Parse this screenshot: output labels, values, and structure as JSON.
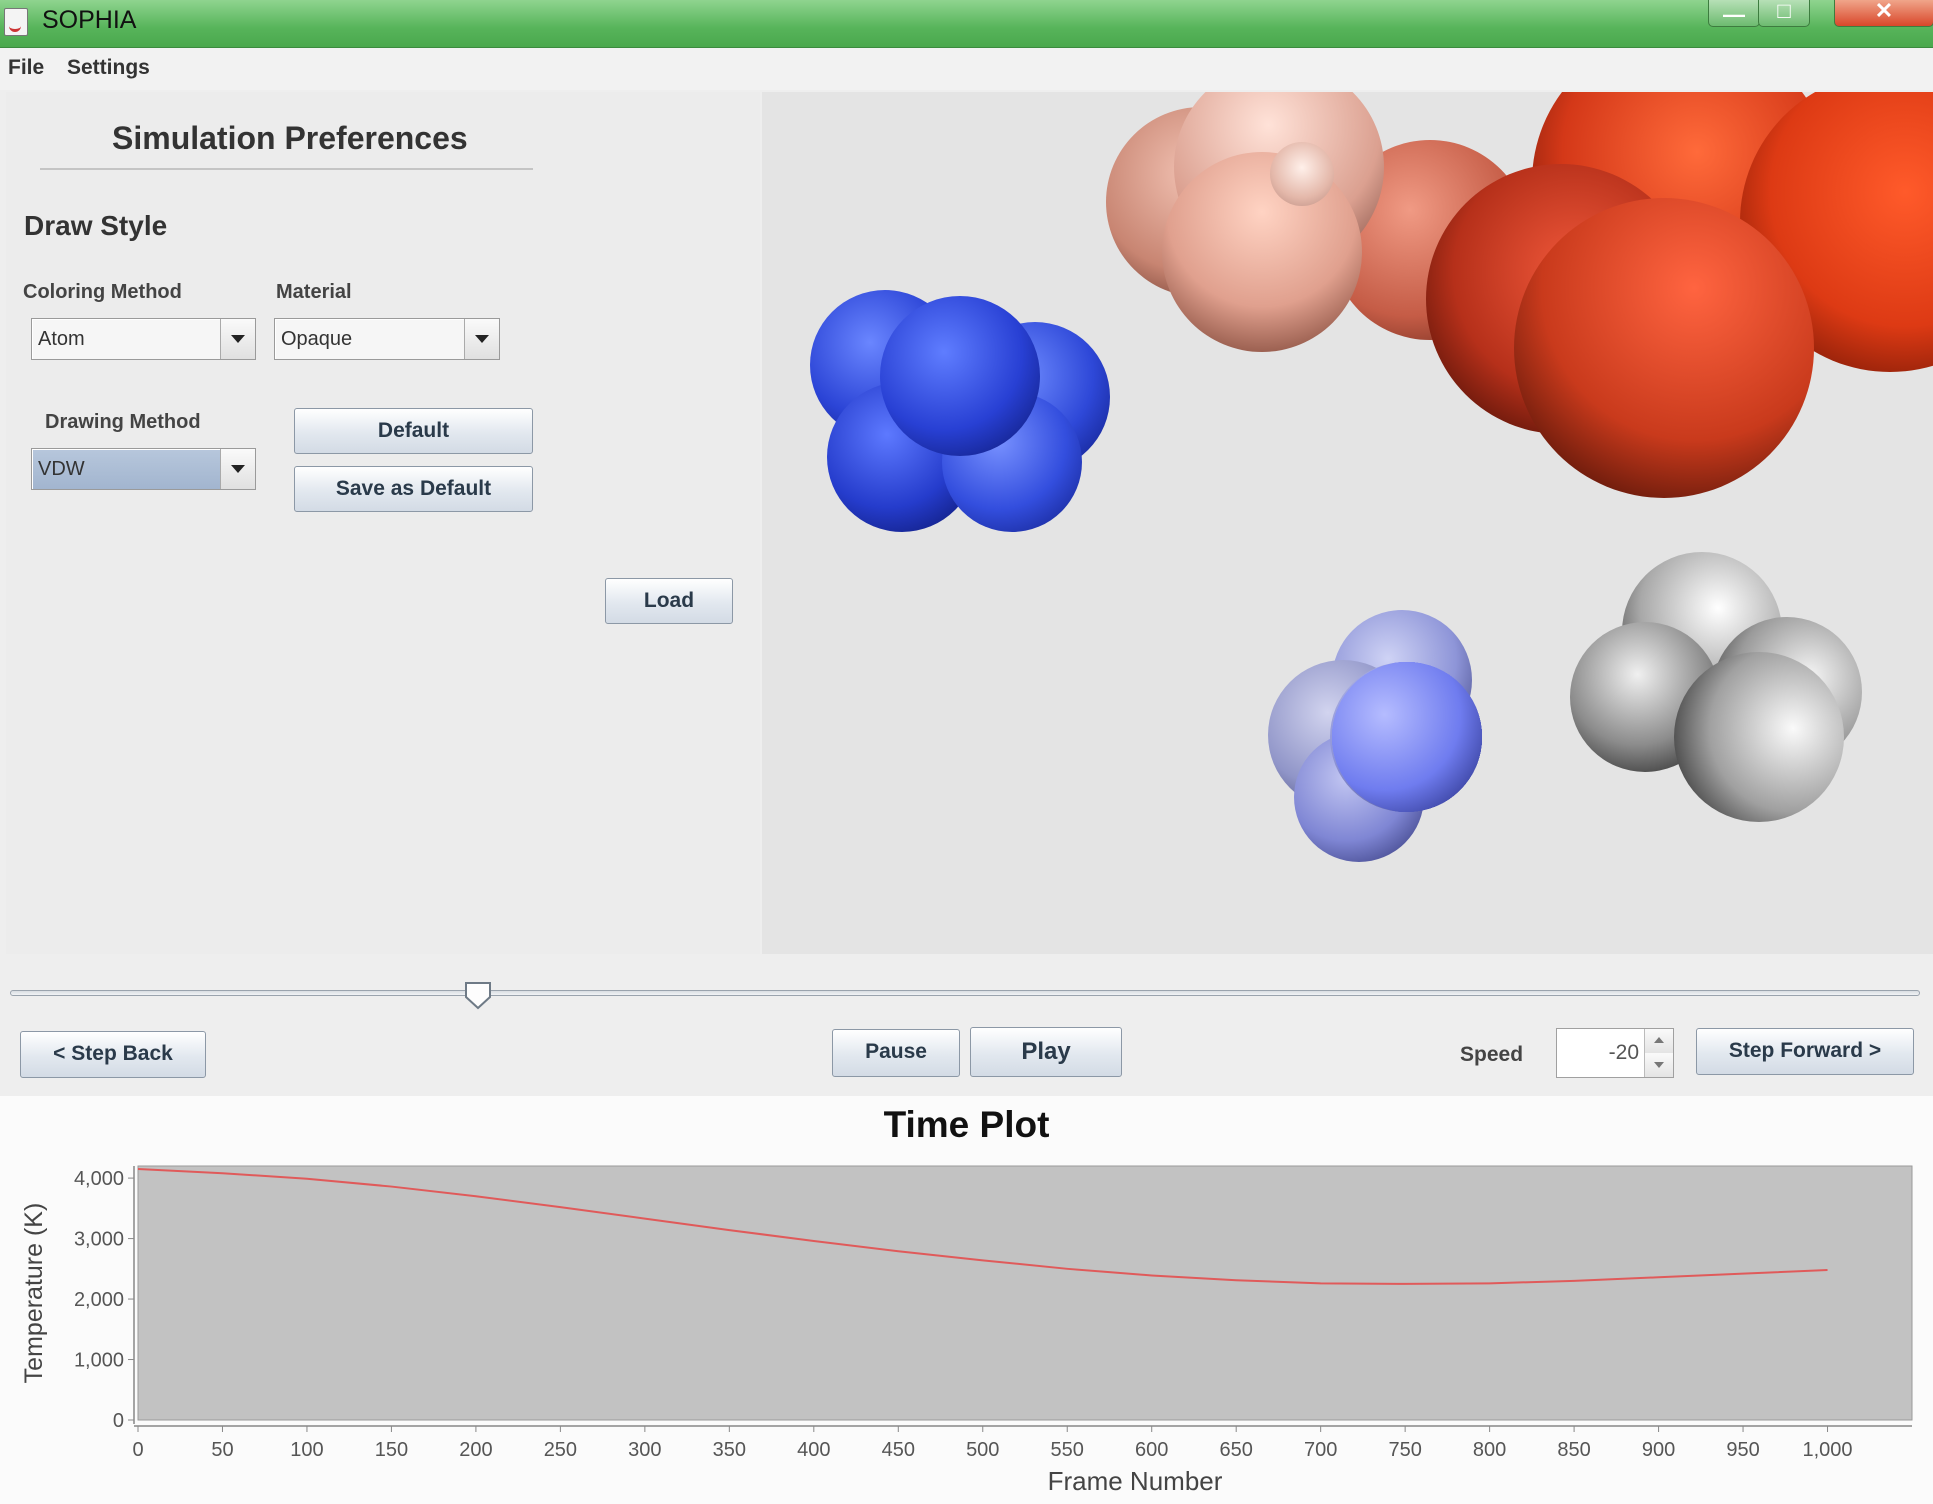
{
  "window": {
    "title": "SOPHIA",
    "min_glyph": "—",
    "max_glyph": "□",
    "close_glyph": "✕"
  },
  "menu": {
    "items": [
      "File",
      "Settings"
    ]
  },
  "preferences": {
    "heading": "Simulation Preferences",
    "section": "Draw Style",
    "coloring_method": {
      "label": "Coloring Method",
      "value": "Atom"
    },
    "material": {
      "label": "Material",
      "value": "Opaque"
    },
    "drawing_method": {
      "label": "Drawing Method",
      "value": "VDW"
    },
    "default_button": "Default",
    "save_default_button": "Save as Default",
    "load_button": "Load"
  },
  "playback": {
    "step_back": "< Step Back",
    "pause": "Pause",
    "play": "Play",
    "speed_label": "Speed",
    "speed_value": "-20",
    "step_forward": "Step Forward >",
    "slider_fraction": 0.245
  },
  "plot": {
    "title": "Time Plot",
    "colors": {
      "background": "#c2c2c2",
      "line": "#e05a5a"
    }
  },
  "chart_data": {
    "type": "line",
    "title": "Time Plot",
    "xlabel": "Frame Number",
    "ylabel": "Temperature (K)",
    "xlim": [
      0,
      1050
    ],
    "ylim": [
      0,
      4200
    ],
    "xticks": [
      0,
      50,
      100,
      150,
      200,
      250,
      300,
      350,
      400,
      450,
      500,
      550,
      600,
      650,
      700,
      750,
      800,
      850,
      900,
      950,
      1000
    ],
    "xtick_labels": [
      "0",
      "50",
      "100",
      "150",
      "200",
      "250",
      "300",
      "350",
      "400",
      "450",
      "500",
      "550",
      "600",
      "650",
      "700",
      "750",
      "800",
      "850",
      "900",
      "950",
      "1,000"
    ],
    "yticks": [
      0,
      1000,
      2000,
      3000,
      4000
    ],
    "ytick_labels": [
      "0",
      "1,000",
      "2,000",
      "3,000",
      "4,000"
    ],
    "series": [
      {
        "x": [
          0,
          50,
          100,
          150,
          200,
          250,
          300,
          350,
          400,
          450,
          500,
          550,
          600,
          650,
          700,
          750,
          800,
          850,
          900,
          950,
          1000
        ],
        "values": [
          4150,
          4080,
          3990,
          3860,
          3700,
          3520,
          3330,
          3140,
          2960,
          2790,
          2640,
          2500,
          2390,
          2310,
          2260,
          2250,
          2260,
          2300,
          2360,
          2420,
          2480
        ]
      }
    ]
  }
}
